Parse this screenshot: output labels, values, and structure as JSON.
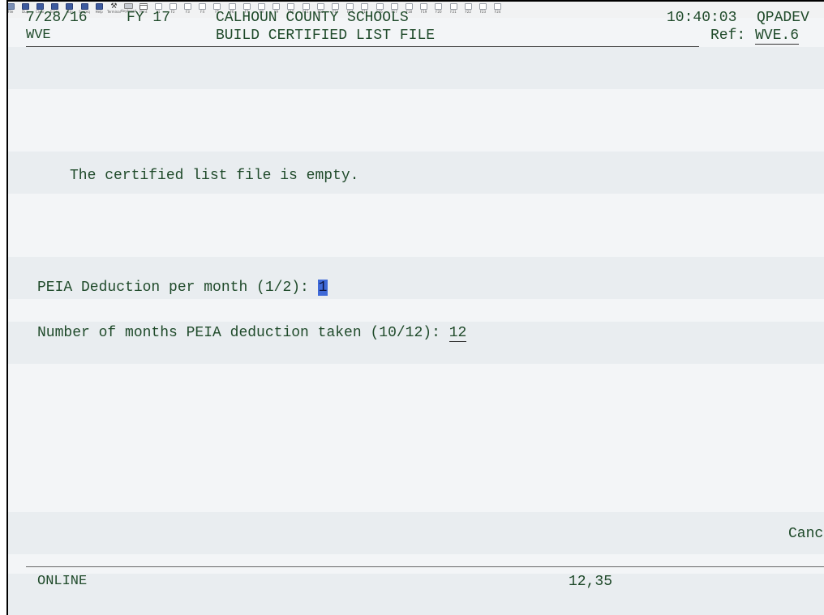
{
  "toolbar": {
    "buttons": [
      {
        "label": "File",
        "icon": "file-icon",
        "style": "key"
      },
      {
        "label": "Dup",
        "icon": "dup-icon",
        "style": ""
      },
      {
        "label": "Clear",
        "icon": "clear-icon",
        "style": ""
      },
      {
        "label": "Erase",
        "icon": "erase-icon",
        "style": ""
      },
      {
        "label": "Attn",
        "icon": "attn-icon",
        "style": ""
      },
      {
        "label": "Sysreq",
        "icon": "sysreq-icon",
        "style": ""
      },
      {
        "label": "Help",
        "icon": "help-icon",
        "style": ""
      },
      {
        "label": "Terminal",
        "icon": "hammer-icon",
        "style": "hammer"
      },
      {
        "label": "Keyboard",
        "icon": "keyboard-icon",
        "style": "kbd"
      },
      {
        "label": "Print",
        "icon": "printer-icon",
        "style": "printer"
      },
      {
        "label": "F1",
        "icon": "f1-key-icon",
        "style": "outline"
      },
      {
        "label": "F2",
        "icon": "f2-key-icon",
        "style": "outline"
      },
      {
        "label": "F3",
        "icon": "f3-key-icon",
        "style": "outline"
      },
      {
        "label": "F4",
        "icon": "f4-key-icon",
        "style": "outline"
      },
      {
        "label": "F5",
        "icon": "f5-key-icon",
        "style": "outline"
      },
      {
        "label": "F6",
        "icon": "f6-key-icon",
        "style": "outline"
      },
      {
        "label": "F7",
        "icon": "f7-key-icon",
        "style": "outline"
      },
      {
        "label": "F8",
        "icon": "f8-key-icon",
        "style": "outline"
      },
      {
        "label": "F9",
        "icon": "f9-key-icon",
        "style": "outline"
      },
      {
        "label": "F10",
        "icon": "f10-key-icon",
        "style": "outline"
      },
      {
        "label": "F11",
        "icon": "f11-key-icon",
        "style": "outline"
      },
      {
        "label": "F12",
        "icon": "f12-key-icon",
        "style": "outline"
      },
      {
        "label": "F13",
        "icon": "f13-key-icon",
        "style": "outline"
      },
      {
        "label": "F14",
        "icon": "f14-key-icon",
        "style": "outline"
      },
      {
        "label": "F15",
        "icon": "f15-key-icon",
        "style": "outline"
      },
      {
        "label": "F16",
        "icon": "f16-key-icon",
        "style": "outline"
      },
      {
        "label": "F17",
        "icon": "f17-key-icon",
        "style": "outline"
      },
      {
        "label": "F18",
        "icon": "f18-key-icon",
        "style": "outline"
      },
      {
        "label": "F19",
        "icon": "f19-key-icon",
        "style": "outline"
      },
      {
        "label": "F20",
        "icon": "f20-key-icon",
        "style": "outline"
      },
      {
        "label": "F21",
        "icon": "f21-key-icon",
        "style": "outline"
      },
      {
        "label": "F22",
        "icon": "f22-key-icon",
        "style": "outline"
      },
      {
        "label": "F23",
        "icon": "f23-key-icon",
        "style": "outline"
      },
      {
        "label": "F24",
        "icon": "f24-key-icon",
        "style": "outline"
      }
    ]
  },
  "header": {
    "date": "7/28/16",
    "fiscal_year": "FY 17",
    "org_name": "CALHOUN COUNTY SCHOOLS",
    "time": "10:40:03",
    "user": "QPADEV",
    "program": "WVE",
    "screen_title": "BUILD CERTIFIED LIST FILE",
    "ref_label": "Ref:",
    "ref_value": "WVE.6"
  },
  "body": {
    "message": "The certified list file is empty.",
    "peia_label": "PEIA Deduction per month (1/2):",
    "peia_value": "1",
    "months_label": "Number of months PEIA deduction taken (10/12):",
    "months_value": "12",
    "cancel_text": "Canc"
  },
  "status": {
    "mode": "ONLINE",
    "cursor_position": "12,35"
  },
  "colors": {
    "text": "#1f4a2a",
    "cursor_highlight": "#3f6ad8",
    "band": "#e9edf0"
  }
}
